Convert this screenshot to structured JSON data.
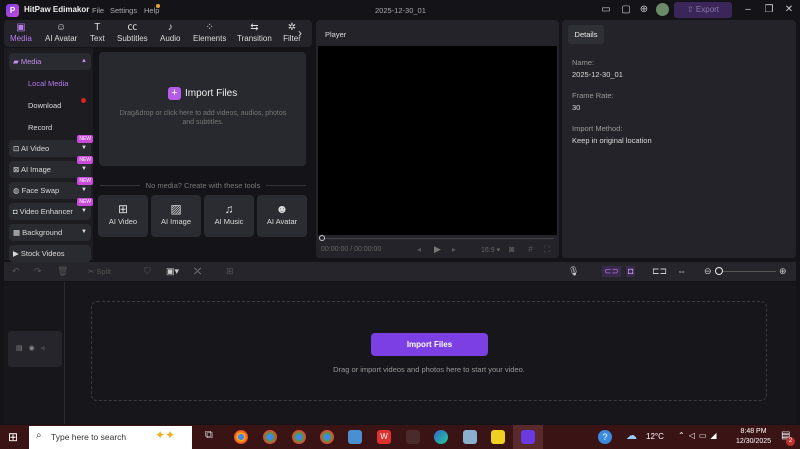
{
  "titlebar": {
    "app_name": "HitPaw Edimakor",
    "menu": [
      "File",
      "Settings",
      "Help"
    ],
    "project_name": "2025-12-30_01",
    "export_label": "Export"
  },
  "tabs": [
    {
      "label": "Media",
      "icon": "media-icon"
    },
    {
      "label": "AI Avatar",
      "icon": "avatar-icon"
    },
    {
      "label": "Text",
      "icon": "text-icon"
    },
    {
      "label": "Subtitles",
      "icon": "subtitles-icon"
    },
    {
      "label": "Audio",
      "icon": "audio-icon"
    },
    {
      "label": "Elements",
      "icon": "elements-icon"
    },
    {
      "label": "Transition",
      "icon": "transition-icon"
    },
    {
      "label": "Filter",
      "icon": "filter-icon"
    }
  ],
  "sidebar": {
    "media": "Media",
    "local_media": "Local Media",
    "download": "Download",
    "record": "Record",
    "items": [
      {
        "label": "AI Video",
        "badge": "NEW"
      },
      {
        "label": "AI Image",
        "badge": "NEW"
      },
      {
        "label": "Face Swap",
        "badge": "NEW"
      },
      {
        "label": "Video Enhancer",
        "badge": "NEW"
      },
      {
        "label": "Background"
      },
      {
        "label": "Stock Videos"
      }
    ]
  },
  "import": {
    "title": "Import Files",
    "hint": "Drag&drop or click here to add videos, audios, photos and subtitles.",
    "no_media": "No media? Create with these tools"
  },
  "tools": [
    "AI Video",
    "AI Image",
    "AI Music",
    "AI Avatar"
  ],
  "player": {
    "title": "Player",
    "time": "00:00:00 / 00:00:00",
    "ratio": "16:9"
  },
  "details": {
    "tab": "Details",
    "name_label": "Name:",
    "name": "2025-12-30_01",
    "frame_rate_label": "Frame Rate:",
    "frame_rate": "30",
    "import_label": "Import Method:",
    "import_method": "Keep in original location"
  },
  "timeline": {
    "split": "Split",
    "import_button": "Import Files",
    "hint": "Drag or import videos and photos here to start your video."
  },
  "taskbar": {
    "search_placeholder": "Type here to search",
    "temp": "12°C",
    "time": "8:48 PM",
    "date": "12/30/2025",
    "notifications": "2"
  }
}
